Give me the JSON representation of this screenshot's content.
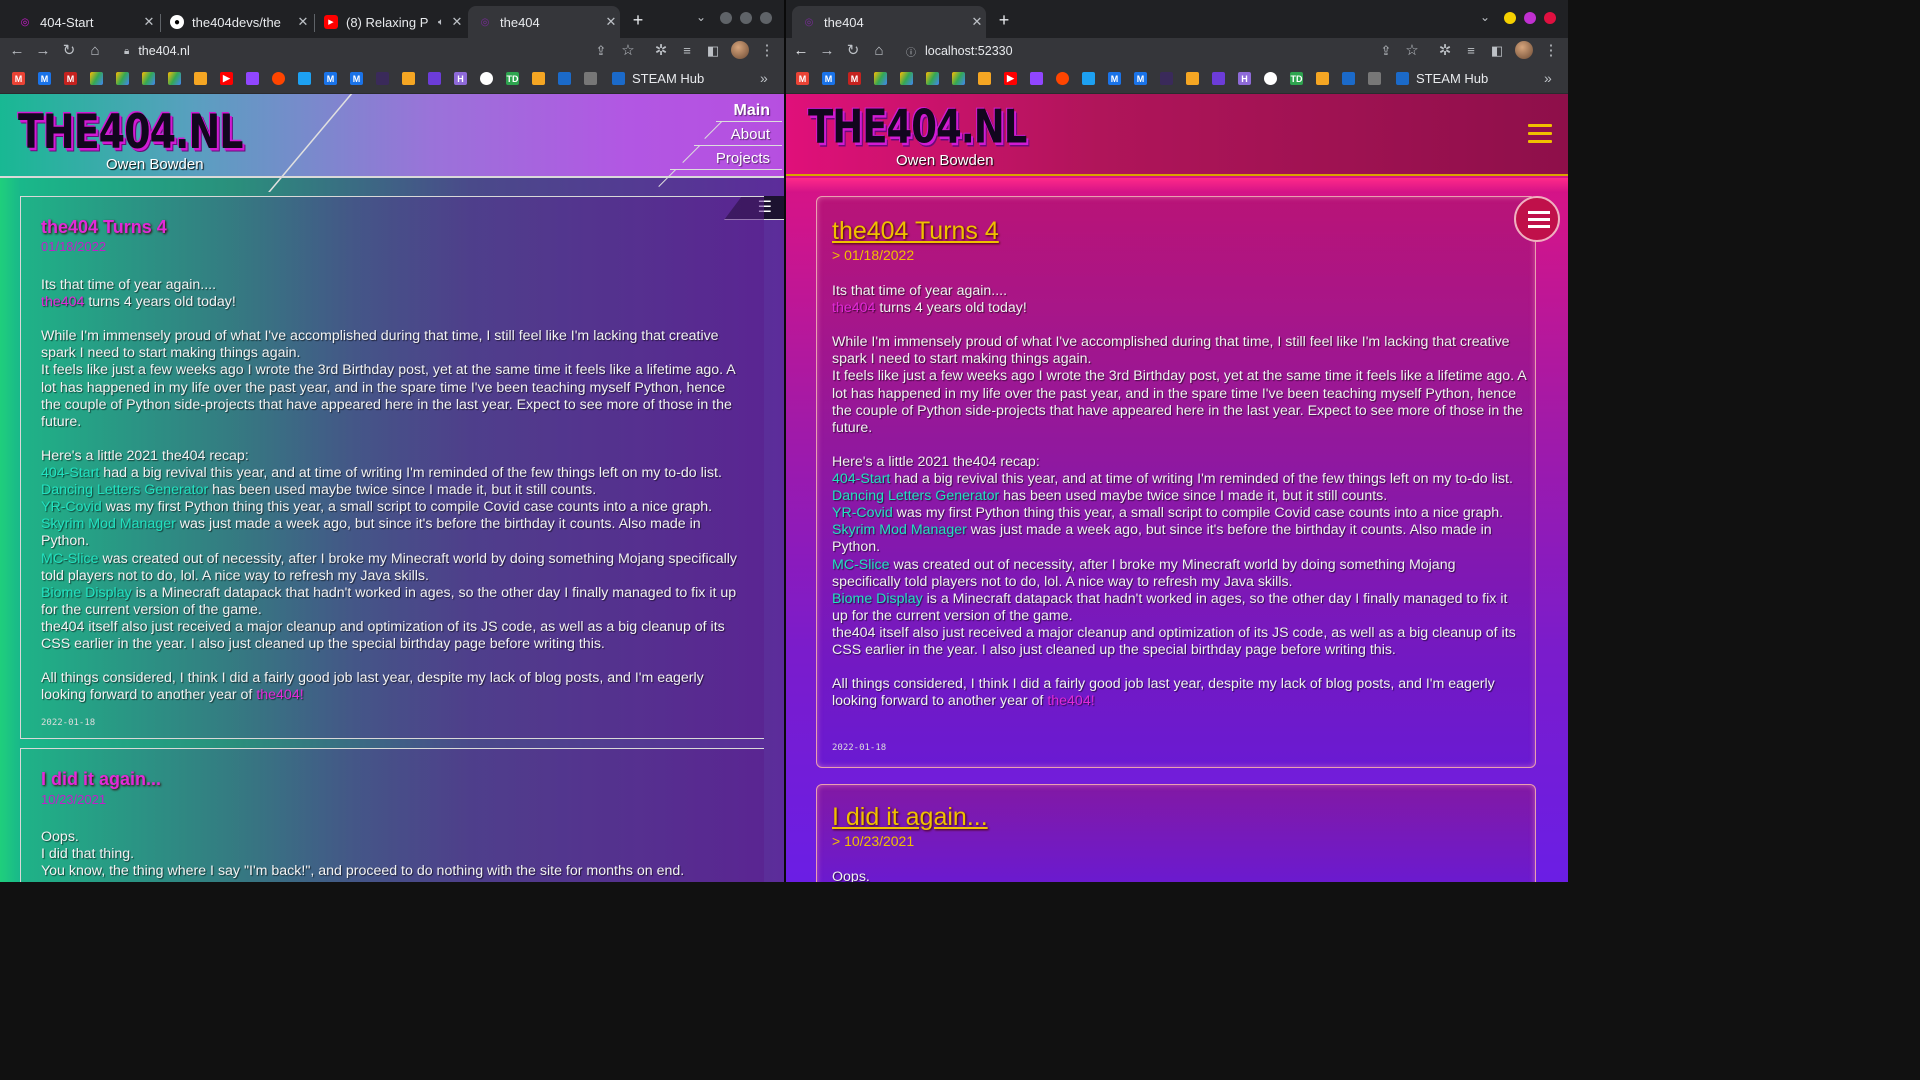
{
  "left": {
    "tabs": [
      {
        "label": "404-Start",
        "close": "✕"
      },
      {
        "label": "the404devs/the",
        "close": "✕"
      },
      {
        "label": "(8) Relaxing P",
        "close": "✕"
      },
      {
        "label": "the404",
        "close": "✕"
      }
    ],
    "url": "the404.nl",
    "bookmark_label": "STEAM Hub",
    "site": {
      "logo": "THE404.NL",
      "subtitle": "Owen Bowden",
      "nav": [
        "Main",
        "About",
        "Projects"
      ],
      "menu_icon": "☰"
    }
  },
  "right": {
    "tabs": [
      {
        "label": "the404",
        "close": "✕"
      }
    ],
    "url": "localhost:52330",
    "bookmark_label": "STEAM Hub",
    "site": {
      "logo": "THE404.NL",
      "subtitle": "Owen Bowden"
    }
  },
  "post1": {
    "title": "the404 Turns 4",
    "date": "01/18/2022",
    "date_prefixed": "> 01/18/2022",
    "intro1": "Its that time of year again....",
    "intro2_link": "the404",
    "intro2_rest": " turns 4 years old today!",
    "para1": "While I'm immensely proud of what I've accomplished during that time, I still feel like I'm lacking that creative spark I need to start making things again.",
    "para2": "It feels like just a few weeks ago I wrote the 3rd Birthday post, yet at the same time it feels like a lifetime ago. A lot has happened in my life over the past year, and in the spare time I've been teaching myself Python, hence the couple of Python side-projects that have appeared here in the last year. Expect to see more of those in the future.",
    "recap_heading": "Here's a little 2021 the404 recap:",
    "recap": [
      {
        "link": "404-Start",
        "text": " had a big revival this year, and at time of writing I'm reminded of the few things left on my to-do list."
      },
      {
        "link": "Dancing Letters Generator",
        "text": " has been used maybe twice since I made it, but it still counts."
      },
      {
        "link": "YR-Covid",
        "text": " was my first Python thing this year, a small script to compile Covid case counts into a nice graph."
      },
      {
        "link": "Skyrim Mod Manager",
        "text": " was just made a week ago, but since it's before the birthday it counts. Also made in Python."
      },
      {
        "link": "MC-Slice",
        "text": " was created out of necessity, after I broke my Minecraft world by doing something Mojang specifically told players not to do, lol. A nice way to refresh my Java skills."
      },
      {
        "link": "Biome Display",
        "text": " is a Minecraft datapack that hadn't worked in ages, so the other day I finally managed to fix it up for the current version of the game."
      }
    ],
    "recap_tail": "the404 itself also just received a major cleanup and optimization of its JS code, as well as a big cleanup of its CSS earlier in the year. I also just cleaned up the special birthday page before writing this.",
    "closing": "All things considered, I think I did a fairly good job last year, despite my lack of blog posts, and I'm eagerly looking forward to another year of ",
    "closing_link": "the404!",
    "stamp": "2022-01-18"
  },
  "post2": {
    "title": "I did it again...",
    "date": "10/23/2021",
    "date_prefixed": "> 10/23/2021",
    "line1": "Oops.",
    "line2": "I did that thing.",
    "line3": "You know, the thing where I say \"I'm back!\", and proceed to do nothing with the site for months on end."
  }
}
